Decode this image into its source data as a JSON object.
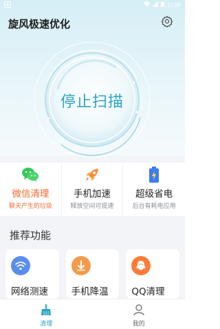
{
  "status_bar": {
    "carrier_icon": "notification-badge-icon",
    "time": "12:06"
  },
  "header": {
    "title": "旋风极速优化",
    "settings_icon": "gear-icon"
  },
  "scan": {
    "label": "停止扫描"
  },
  "features": [
    {
      "title": "微信清理",
      "subtitle": "聊天产生的垃圾",
      "icon": "wechat-icon",
      "accent": true
    },
    {
      "title": "手机加速",
      "subtitle": "释放空间可提速",
      "icon": "rocket-icon",
      "accent": false
    },
    {
      "title": "超级省电",
      "subtitle": "后台有耗电应用",
      "icon": "battery-icon",
      "accent": false
    }
  ],
  "recommend": {
    "section_title": "推荐功能",
    "items": [
      {
        "label": "网络测速",
        "icon": "wifi-icon",
        "color": "#5a8df0"
      },
      {
        "label": "手机降温",
        "icon": "thermometer-icon",
        "color": "#f59a4a"
      },
      {
        "label": "QQ清理",
        "icon": "qq-icon",
        "color": "#ff7b3a"
      }
    ]
  },
  "nav": {
    "items": [
      {
        "label": "清理",
        "icon": "broom-icon",
        "active": true
      },
      {
        "label": "我的",
        "icon": "user-icon",
        "active": false
      }
    ]
  },
  "colors": {
    "accent": "#2aa3c4",
    "orange": "#f06a2b"
  }
}
